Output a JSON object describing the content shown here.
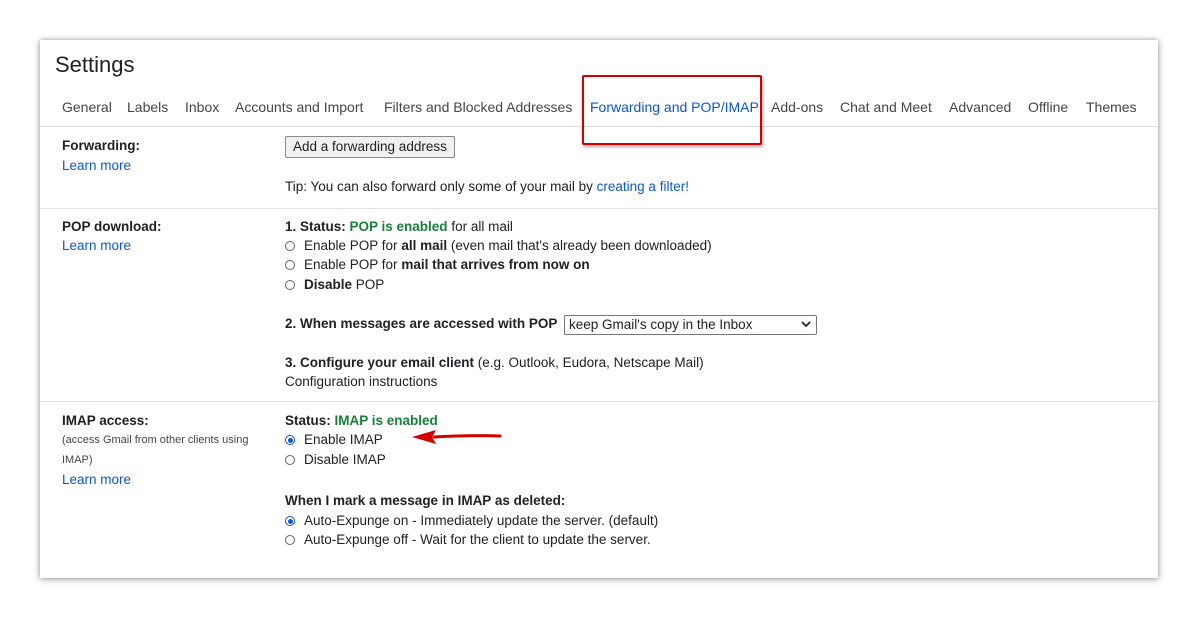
{
  "page": {
    "title": "Settings"
  },
  "tabs": [
    {
      "label": "General"
    },
    {
      "label": "Labels"
    },
    {
      "label": "Inbox"
    },
    {
      "label": "Accounts and Import"
    },
    {
      "label": "Filters and Blocked Addresses"
    },
    {
      "label": "Forwarding and POP/IMAP",
      "active": true
    },
    {
      "label": "Add-ons"
    },
    {
      "label": "Chat and Meet"
    },
    {
      "label": "Advanced"
    },
    {
      "label": "Offline"
    },
    {
      "label": "Themes"
    }
  ],
  "forwarding": {
    "label": "Forwarding:",
    "learn_more": "Learn more",
    "button": "Add a forwarding address",
    "tip_prefix": "Tip: You can also forward only some of your mail by ",
    "tip_link": "creating a filter!"
  },
  "pop": {
    "label": "POP download:",
    "learn_more": "Learn more",
    "status_prefix": "1. Status: ",
    "status_value": "POP is enabled",
    "status_suffix": " for all mail",
    "options": [
      {
        "pre": "Enable POP for ",
        "bold": "all mail",
        "post": " (even mail that's already been downloaded)",
        "checked": false
      },
      {
        "pre": "Enable POP for ",
        "bold": "mail that arrives from now on",
        "post": "",
        "checked": false
      },
      {
        "pre": "",
        "bold": "Disable",
        "post": " POP",
        "checked": false
      }
    ],
    "access_label": "2. When messages are accessed with POP",
    "access_select": "keep Gmail's copy in the Inbox",
    "configure_bold": "3. Configure your email client",
    "configure_rest": " (e.g. Outlook, Eudora, Netscape Mail)",
    "configure_link": "Configuration instructions"
  },
  "imap": {
    "label": "IMAP access:",
    "sublabel": "(access Gmail from other clients using IMAP)",
    "learn_more": "Learn more",
    "status_prefix": "Status: ",
    "status_value": "IMAP is enabled",
    "options": [
      {
        "label": "Enable IMAP",
        "checked": true
      },
      {
        "label": "Disable IMAP",
        "checked": false
      }
    ],
    "deleted_heading": "When I mark a message in IMAP as deleted:",
    "expunge": [
      {
        "label": "Auto-Expunge on - Immediately update the server. (default)",
        "checked": true
      },
      {
        "label": "Auto-Expunge off - Wait for the client to update the server.",
        "checked": false
      }
    ]
  },
  "annotations": {
    "highlight_color": "#d40000",
    "arrow_color": "#d40000",
    "accent": "#0b57d0",
    "status_green": "#188038"
  }
}
